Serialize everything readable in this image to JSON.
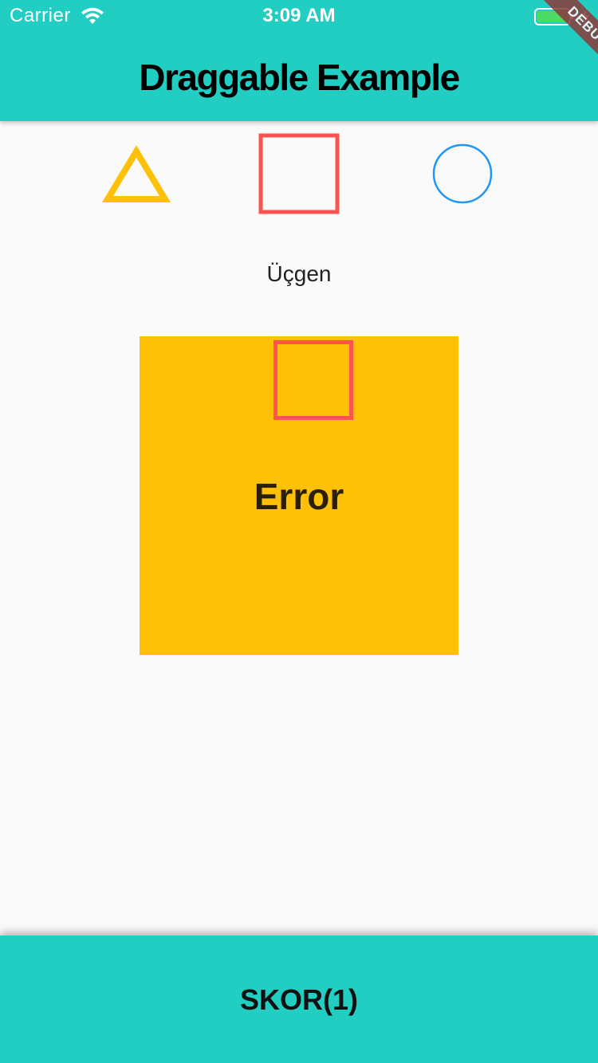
{
  "status_bar": {
    "carrier": "Carrier",
    "time": "3:09 AM"
  },
  "app_bar": {
    "title": "Draggable Example"
  },
  "debug_banner": "DEBUG",
  "shapes": [
    {
      "kind": "triangle",
      "color": "#ffc107"
    },
    {
      "kind": "square",
      "color": "#ff5252"
    },
    {
      "kind": "circle",
      "color": "#2196f3"
    }
  ],
  "label": "Üçgen",
  "drop_target": {
    "color": "#ffc107",
    "text": "Error",
    "held_shape": "square"
  },
  "bottom_bar": {
    "score": "SKOR(1)"
  },
  "colors": {
    "app_bar": "#22cec2",
    "background": "#fafafa"
  }
}
